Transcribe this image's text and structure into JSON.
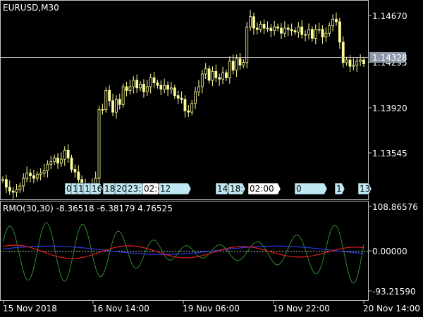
{
  "window": {
    "symbol_label": "EURUSD,M30",
    "indicator_label": "RMO(30,30) -8.36518 -6.38179 4.76525"
  },
  "colors": {
    "background": "#000000",
    "candle": "#FFFF99",
    "grid_line": "#C0C0C0",
    "current_price_box": "#8A98A8",
    "tag_fill": "#BFE9F2",
    "tag_fill_white": "#FFFFFF",
    "green_line": "#2E8B2E",
    "red_line": "#E02020",
    "blue_line": "#2A3BE0",
    "zero_line": "#C0C0C0"
  },
  "price_axis": {
    "ticks": [
      "1.14670",
      "1.14295",
      "1.13920",
      "1.13545"
    ],
    "current_price": "1.14328"
  },
  "indicator_axis": {
    "ticks": [
      "108.86576",
      "0.00000",
      "-93.21590"
    ]
  },
  "time_axis": {
    "ticks": [
      "15 Nov 2018",
      "16 Nov 14:00",
      "19 Nov 06:00",
      "19 Nov 22:00",
      "20 Nov 14:00"
    ]
  },
  "event_tags": [
    {
      "text": "0"
    },
    {
      "text": "1"
    },
    {
      "text": "1"
    },
    {
      "text": "13"
    },
    {
      "text": "16"
    },
    {
      "text": "18"
    },
    {
      "text": "20"
    },
    {
      "text": "23:"
    },
    {
      "text": "02:00"
    },
    {
      "text": "12"
    },
    {
      "text": "14"
    },
    {
      "text": "18:30"
    },
    {
      "text": "02:00"
    },
    {
      "text": "0"
    },
    {
      "text": "1"
    },
    {
      "text": "13"
    }
  ],
  "chart_data": {
    "type": "candlestick",
    "price_series": {
      "name": "EURUSD,M30",
      "ylim": [
        1.1325,
        1.148
      ],
      "close": [
        1.134,
        1.1334,
        1.1331,
        1.133,
        1.1332,
        1.1335,
        1.1341,
        1.1345,
        1.1343,
        1.1341,
        1.1344,
        1.1345,
        1.1347,
        1.1352,
        1.1354,
        1.1357,
        1.1353,
        1.1356,
        1.1363,
        1.1357,
        1.1348,
        1.1346,
        1.134,
        1.1336,
        1.1333,
        1.1335,
        1.1337,
        1.1341,
        1.1395,
        1.1395,
        1.141,
        1.1402,
        1.1393,
        1.1403,
        1.1399,
        1.1413,
        1.141,
        1.1413,
        1.1418,
        1.1412,
        1.1415,
        1.1409,
        1.1413,
        1.142,
        1.1416,
        1.1414,
        1.1411,
        1.1414,
        1.1411,
        1.1412,
        1.1406,
        1.1404,
        1.1403,
        1.1394,
        1.1393,
        1.14,
        1.1409,
        1.1413,
        1.1423,
        1.1427,
        1.1418,
        1.1425,
        1.142,
        1.1419,
        1.1424,
        1.142,
        1.1433,
        1.1426,
        1.1435,
        1.143,
        1.1432,
        1.146,
        1.1468,
        1.1459,
        1.1458,
        1.1462,
        1.1459,
        1.1459,
        1.1457,
        1.146,
        1.1459,
        1.1455,
        1.1459,
        1.1458,
        1.1457,
        1.1456,
        1.146,
        1.1454,
        1.1454,
        1.1458,
        1.1451,
        1.1458,
        1.1458,
        1.1452,
        1.1455,
        1.1461,
        1.1466,
        1.1464,
        1.1448,
        1.1432,
        1.1434,
        1.1429,
        1.143,
        1.1433,
        1.1434,
        1.1431
      ]
    },
    "indicator_series": [
      {
        "name": "-8.36518"
      },
      {
        "name": "-6.38179"
      },
      {
        "name": "4.76525"
      }
    ],
    "indicator_ylim": [
      -93.2159,
      108.86576
    ]
  }
}
